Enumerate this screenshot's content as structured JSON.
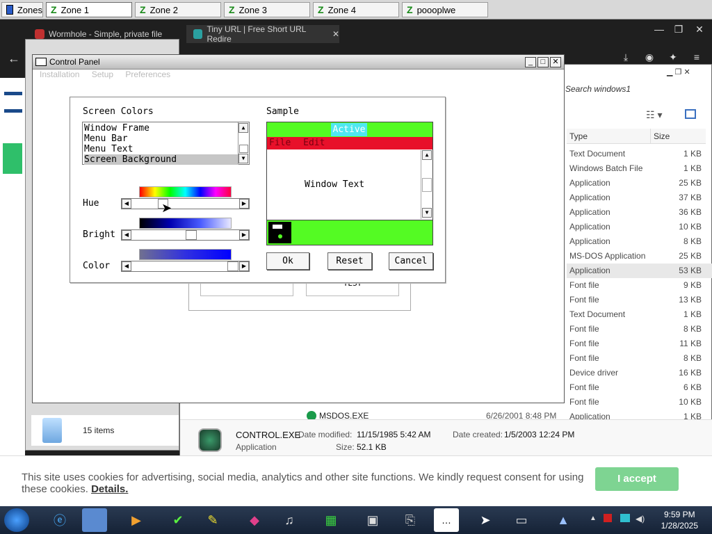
{
  "zones": {
    "label": "Zones",
    "items": [
      "Zone 1",
      "Zone 2",
      "Zone 3",
      "Zone 4",
      "poooplwe"
    ]
  },
  "browser": {
    "tabs": [
      "Wormhole - Simple, private file",
      "Tiny URL | Free Short URL Redire"
    ]
  },
  "explorer": {
    "search_placeholder": "Search windows1",
    "col_type": "Type",
    "col_size": "Size",
    "files": [
      {
        "type": "Text Document",
        "size": "1 KB"
      },
      {
        "type": "Windows Batch File",
        "size": "1 KB"
      },
      {
        "type": "Application",
        "size": "25 KB"
      },
      {
        "type": "Application",
        "size": "37 KB"
      },
      {
        "type": "Application",
        "size": "36 KB"
      },
      {
        "type": "Application",
        "size": "10 KB"
      },
      {
        "type": "Application",
        "size": "8 KB"
      },
      {
        "type": "MS-DOS Application",
        "size": "25 KB"
      },
      {
        "type": "Application",
        "size": "53 KB"
      },
      {
        "type": "Font file",
        "size": "9 KB"
      },
      {
        "type": "Font file",
        "size": "13 KB"
      },
      {
        "type": "Text Document",
        "size": "1 KB"
      },
      {
        "type": "Font file",
        "size": "8 KB"
      },
      {
        "type": "Font file",
        "size": "11 KB"
      },
      {
        "type": "Font file",
        "size": "8 KB"
      },
      {
        "type": "Device driver",
        "size": "16 KB"
      },
      {
        "type": "Font file",
        "size": "6 KB"
      },
      {
        "type": "Font file",
        "size": "10 KB"
      },
      {
        "type": "Application",
        "size": "1 KB"
      }
    ],
    "msdos_row": {
      "name": "MSDOS.EXE",
      "date": "6/26/2001 8:48 PM"
    },
    "details": {
      "name": "CONTROL.EXE",
      "kind": "Application",
      "modified_label": "Date modified:",
      "modified": "11/15/1985 5:42 AM",
      "created_label": "Date created:",
      "created": "1/5/2003 12:24 PM",
      "size_label": "Size:",
      "size": "52.1 KB"
    }
  },
  "left_window": {
    "items_count": "15 items"
  },
  "control_panel": {
    "title": "Control Panel",
    "menu": [
      "Installation",
      "Setup",
      "Preferences"
    ],
    "screen_colors_label": "Screen Colors",
    "color_items": [
      "Window Frame",
      "Menu Bar",
      "Menu Text",
      "Screen Background"
    ],
    "selected_index": 3,
    "hue_label": "Hue",
    "bright_label": "Bright",
    "color_label": "Color",
    "sample_label": "Sample",
    "sample_active": "Active",
    "sample_menu": [
      "File",
      "Edit"
    ],
    "sample_window_text": "Window Text",
    "ok": "Ok",
    "reset": "Reset",
    "cancel": "Cancel",
    "hidden_btn": "TEST",
    "colors": {
      "sample_bg": "#54fb23",
      "sample_menu": "#e8102a",
      "sample_active": "#4fe8f0"
    }
  },
  "cookie": {
    "text": "This site uses cookies for advertising, social media, analytics and other site functions. We kindly request consent for using these cookies.",
    "details": "Details.",
    "accept": "I accept"
  },
  "taskbar": {
    "time": "9:59 PM",
    "date": "1/28/2025",
    "icons": [
      "start-orb-icon",
      "ie-icon",
      "explorer-icon",
      "media-icon",
      "fox-icon",
      "edit-icon",
      "stack-icon",
      "music-icon",
      "sheet-icon",
      "folder-tool-icon",
      "network-icon",
      "dots-icon",
      "cursor-icon",
      "window-icon",
      "picture-icon"
    ]
  }
}
